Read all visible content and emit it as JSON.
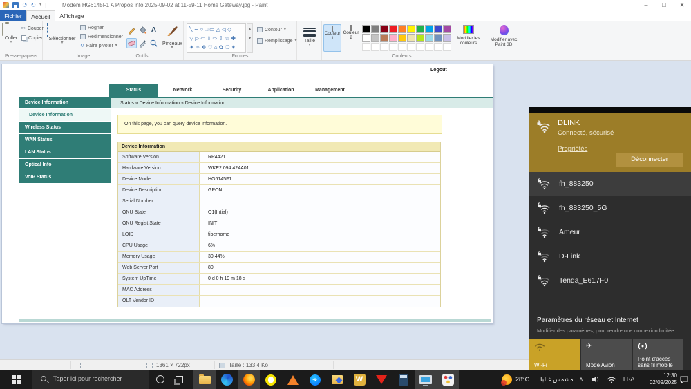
{
  "colors": {
    "teal": "#2F7D76",
    "panel_gold": "#9C7D28",
    "tile_gold": "#C9A227",
    "file_tab_blue": "#2A66B8",
    "taskbar_bg": "#1B1B1B"
  },
  "icons": {
    "dropdown": "▾",
    "scroll_up": "▴",
    "scroll_down": "▾",
    "scissors": "✂",
    "undo": "↺",
    "redo": "↻",
    "rotate": "↻",
    "minimize": "–",
    "maximize": "□",
    "close": "✕",
    "separator": "|",
    "chevron_up": "∧",
    "airplane": "✈"
  },
  "paint": {
    "window_title": "Modem HG6145F1 A Propos info 2025-09-02 at 11-59-11 Home Gateway.jpg - Paint",
    "menu": {
      "file": "Fichier",
      "home": "Accueil",
      "view": "Affichage"
    },
    "ribbon": {
      "clipboard": {
        "group": "Presse-papiers",
        "paste": "Coller",
        "cut": "Couper",
        "copy": "Copier"
      },
      "image": {
        "group": "Image",
        "select": "Sélectionner",
        "crop": "Rogner",
        "resize": "Redimensionner",
        "rotate": "Faire pivoter"
      },
      "tools": {
        "group": "Outils",
        "text_tool": "A"
      },
      "brushes": {
        "label": "Pinceaux"
      },
      "shapes": {
        "group": "Formes",
        "outline": "Contour",
        "fill": "Remplissage",
        "row1": "╲∼○□▭△◁◇",
        "row2": "▽▷⇦⇧⇨⇩☆✚",
        "row3": "✦✧❖♡⌂✿❍✶"
      },
      "size": {
        "label": "Taille"
      },
      "colors": {
        "group": "Couleurs",
        "word": "Couleur",
        "one": "1",
        "two": "2",
        "edit": "Modifier les couleurs",
        "palette_row1": [
          "#000000",
          "#7F7F7F",
          "#880015",
          "#ED1C24",
          "#FF7F27",
          "#FFF200",
          "#22B14C",
          "#00A2E8",
          "#3F48CC",
          "#A349A4"
        ],
        "palette_row2": [
          "#FFFFFF",
          "#C3C3C3",
          "#B97A57",
          "#FFAEC9",
          "#FFC90E",
          "#EFE4B0",
          "#B5E61D",
          "#99D9EA",
          "#7092BE",
          "#C8BFE7"
        ]
      },
      "paint3d": {
        "label": "Modifier avec Paint 3D"
      }
    },
    "statusbar": {
      "dimensions": "1361 × 722px",
      "file_size": "Taille : 133,4 Ko"
    }
  },
  "router_ui": {
    "logout": "Logout",
    "tabs": [
      "Status",
      "Network",
      "Security",
      "Application",
      "Management"
    ],
    "breadcrumb": "Status » Device Information » Device Information",
    "sidebar": [
      "Device Information",
      "Device Information",
      "Wireless Status",
      "WAN Status",
      "LAN Status",
      "Optical Info",
      "VoIP Status"
    ],
    "note": "On this page, you can query device information.",
    "table": {
      "header": "Device Information",
      "rows": [
        [
          "Software Version",
          "RP4421"
        ],
        [
          "Hardware Version",
          "WKE2.094.424A01"
        ],
        [
          "Device Model",
          "HG6145F1"
        ],
        [
          "Device Description",
          "GPON"
        ],
        [
          "Serial Number",
          ""
        ],
        [
          "ONU State",
          "O1(Intial)"
        ],
        [
          "ONU Regist State",
          "INIT"
        ],
        [
          "LOID",
          "fiberhome"
        ],
        [
          "CPU Usage",
          "6%"
        ],
        [
          "Memory Usage",
          "30.44%"
        ],
        [
          "Web Server Port",
          "80"
        ],
        [
          "System UpTime",
          "0 d 0 h 19 m 18 s"
        ],
        [
          "MAC Address",
          ""
        ],
        [
          "OLT Vendor ID",
          ""
        ]
      ]
    }
  },
  "wifi_panel": {
    "connected": {
      "ssid": "DLINK",
      "status": "Connecté, sécurisé",
      "properties": "Propriétés",
      "disconnect": "Déconnecter"
    },
    "networks": [
      "fh_883250",
      "fh_883250_5G",
      "Ameur",
      "D-Link",
      "Tenda_E617F0"
    ],
    "settings_title": "Paramètres du réseau et Internet",
    "settings_hint": "Modifier des paramètres, pour rendre une connexion limitée.",
    "tiles": {
      "wifi": "Wi-Fi",
      "airplane": "Mode Avion",
      "hotspot_line1": "Point d'accès",
      "hotspot_line2": "sans fil mobile"
    }
  },
  "taskbar": {
    "search": "Taper ici pour rechercher",
    "w_app": "W",
    "weather_temp": "28°C",
    "weather_text": "مشمس غالبا",
    "lang": "FRA",
    "time": "12:30",
    "date": "02/09/2025"
  }
}
